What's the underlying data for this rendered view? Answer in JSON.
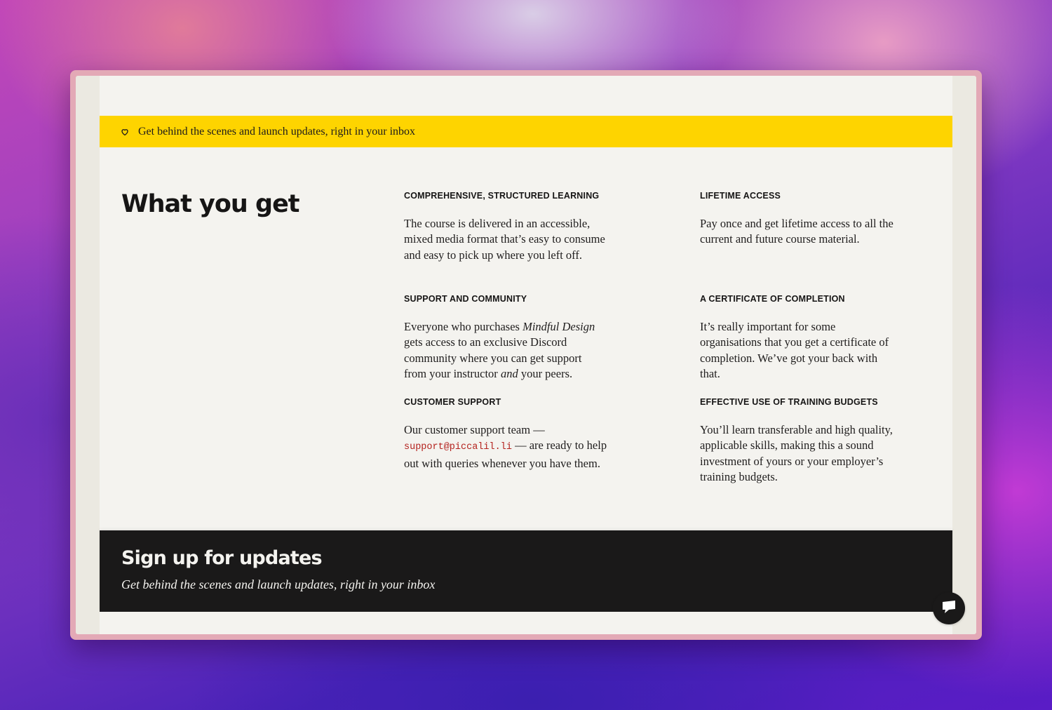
{
  "banner": {
    "icon": "heart-icon",
    "text": "Get behind the scenes and launch updates, right in your inbox"
  },
  "section": {
    "title": "What you get"
  },
  "features": [
    {
      "heading": "COMPREHENSIVE, STRUCTURED LEARNING",
      "body": "The course is delivered in an accessible, mixed media format that’s easy to consume and easy to pick up where you left off."
    },
    {
      "heading": "LIFETIME ACCESS",
      "body": "Pay once and get lifetime access to all the current and future course material."
    },
    {
      "heading": "SUPPORT AND COMMUNITY",
      "body_parts": [
        "Everyone who purchases ",
        "Mindful Design",
        " gets access to an exclusive Discord community where you can get support from your instructor ",
        "and",
        " your peers."
      ]
    },
    {
      "heading": "A CERTIFICATE OF COMPLETION",
      "body": "It’s really important for some organisations that you get a certificate of completion. We’ve got your back with that."
    },
    {
      "heading": "CUSTOMER SUPPORT",
      "body_parts": [
        "Our customer support team — ",
        "support@piccalil.li",
        " — are ready to help out with queries whenever you have them."
      ]
    },
    {
      "heading": "EFFECTIVE USE OF TRAINING BUDGETS",
      "body": "You’ll learn transferable and high quality, applicable skills, making this a sound investment of yours or your employer’s training budgets."
    }
  ],
  "signup": {
    "title": "Sign up for updates",
    "subtitle": "Get behind the scenes and launch updates, right in your inbox"
  },
  "chat": {
    "icon": "chat-bubble-icon"
  },
  "colors": {
    "banner_bg": "#fed400",
    "page_bg": "#f4f3ef",
    "dark_bg": "#1a1919",
    "link_red": "#b4221e"
  }
}
